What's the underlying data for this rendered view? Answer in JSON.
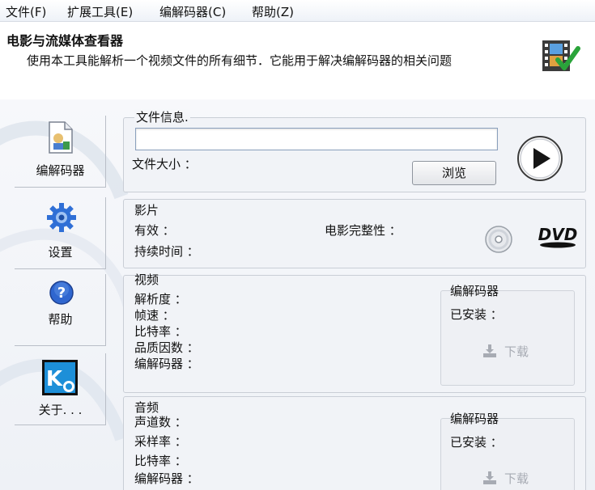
{
  "menu": [
    "文件(F)",
    "扩展工具(E)",
    "编解码器(C)",
    "帮助(Z)"
  ],
  "header": {
    "title": "电影与流媒体查看器",
    "subtitle": "使用本工具能解析一个视频文件的所有细节．它能用于解决编解码器的相关问题"
  },
  "sidebar": [
    {
      "label": "编解码器",
      "icon": "codec-doc-icon"
    },
    {
      "label": "设置",
      "icon": "gear-icon"
    },
    {
      "label": "帮助",
      "icon": "help-icon"
    },
    {
      "label": "关于. . .",
      "icon": "k-lite-logo-icon"
    }
  ],
  "file_info": {
    "title": "文件信息.",
    "path_value": "",
    "size_label": "文件大小 ：",
    "browse_label": "浏览"
  },
  "movie": {
    "title": "影片",
    "valid_label": "有效 ：",
    "duration_label": "持续时间 ：",
    "integrity_label": "电影完整性 ："
  },
  "video": {
    "title": "视频",
    "fields": [
      "解析度 ：",
      "帧速 ：",
      "比特率 ：",
      "品质因数 ：",
      "编解码器 ："
    ],
    "codec_box": {
      "title": "编解码器",
      "installed_label": "已安装 ：",
      "download_label": "下载"
    }
  },
  "audio": {
    "title": "音频",
    "fields": [
      "声道数 ：",
      "采样率 ：",
      "比特率 ：",
      "编解码器 ："
    ],
    "codec_box": {
      "title": "编解码器",
      "installed_label": "已安装 ：",
      "download_label": "下载"
    }
  },
  "colors": {
    "panel_bg": "#f1f3f7",
    "check_green": "#2aa43a",
    "gear_blue": "#2f6fd6"
  }
}
